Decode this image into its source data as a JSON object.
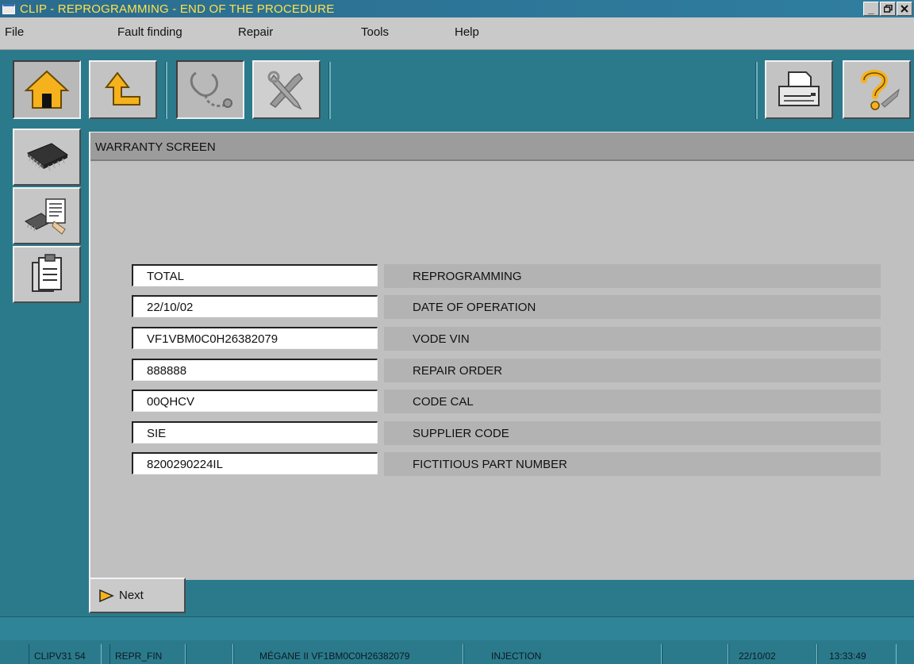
{
  "window": {
    "title": "CLIP - REPROGRAMMING - END OF THE PROCEDURE",
    "controls": [
      "_",
      "ɘ",
      "×"
    ]
  },
  "menu": {
    "items": [
      "File",
      "Fault finding",
      "Repair",
      "Tools",
      "Help"
    ]
  },
  "toolbar": {
    "buttons": [
      "home-icon",
      "up-arrow-icon",
      "stethoscope-icon",
      "tools-icon",
      "printer-icon",
      "help-icon"
    ]
  },
  "sidebar": {
    "buttons": [
      "chip-icon",
      "chip-document-icon",
      "clipboard-icon"
    ]
  },
  "panel": {
    "title": "WARRANTY SCREEN",
    "rows": [
      {
        "value": "TOTAL",
        "label": "REPROGRAMMING"
      },
      {
        "value": "22/10/02",
        "label": "DATE OF OPERATION"
      },
      {
        "value": "VF1VBM0C0H26382079",
        "label": "VODE VIN"
      },
      {
        "value": "888888",
        "label": "REPAIR ORDER"
      },
      {
        "value": "00QHCV",
        "label": "CODE CAL"
      },
      {
        "value": "SIE",
        "label": "SUPPLIER CODE"
      },
      {
        "value": "8200290224IL",
        "label": "FICTITIOUS PART NUMBER"
      }
    ]
  },
  "actions": {
    "next_label": "Next"
  },
  "status": {
    "version": "CLIPV31 54",
    "screen": "REPR_FIN",
    "vehicle": "MÉGANE II VF1BM0C0H26382079",
    "system": "INJECTION",
    "date": "22/10/02",
    "time": "13:33:49"
  },
  "colors": {
    "title_text": "#ffe24a",
    "background": "#2a7a8c",
    "panel": "#c0c0c0"
  }
}
